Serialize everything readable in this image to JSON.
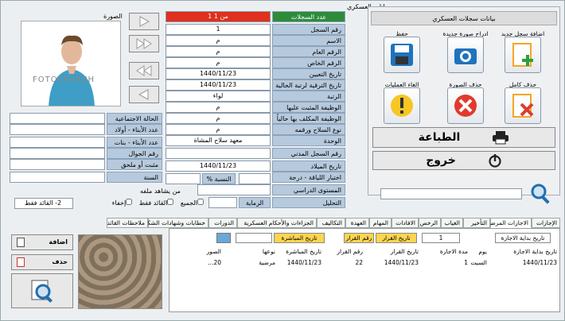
{
  "window": {
    "title": "بيانات العسكري"
  },
  "photo": {
    "label": "الصورة",
    "watermark": "FOTOSEARCH"
  },
  "record_header": {
    "label": "عدد السجلات",
    "value": "1 من 1"
  },
  "form_main": [
    {
      "label": "رقم السجل",
      "value": "1"
    },
    {
      "label": "الاسم",
      "value": "م"
    },
    {
      "label": "الرقم العام",
      "value": "م"
    },
    {
      "label": "الرقم الخاص",
      "value": "م"
    },
    {
      "label": "تاريخ التعيين",
      "value": "1440/11/23"
    },
    {
      "label": "تاريخ الترقية لرتبة الحالية",
      "value": "1440/11/23"
    },
    {
      "label": "الرتبة",
      "value": "لواء"
    },
    {
      "label": "الوظيفة المثبت عليها",
      "value": "م"
    },
    {
      "label": "الوظيفة المكلف بها حالياً",
      "value": "م"
    },
    {
      "label": "نوع السلاح ورقمه",
      "value": "م"
    },
    {
      "label": "الوحدة",
      "value": "معهد سلاح المشاة"
    },
    {
      "label": "رقم السجل المدني",
      "value": ""
    },
    {
      "label": "تاريخ الميلاد",
      "value": "1440/11/23"
    },
    {
      "label": "اختبار اللياقة - درجة",
      "value": ""
    },
    {
      "label": "المستوى الدراسي",
      "value": ""
    },
    {
      "label": "التحليل",
      "value": ""
    }
  ],
  "percent_label": "النسبة %",
  "rank_label": "الرماية",
  "form_left": [
    {
      "label": "الحالة الاجتماعية",
      "value": ""
    },
    {
      "label": "عدد الأبناء - أولاد",
      "value": ""
    },
    {
      "label": "عدد الأبناء - بنات",
      "value": ""
    },
    {
      "label": "رقم الجوال",
      "value": ""
    },
    {
      "label": "مثبت أو ملحق",
      "value": ""
    },
    {
      "label": "السنة",
      "value": ""
    }
  ],
  "viewer": {
    "label": "من يشاهد ملفه",
    "options": [
      "الجميع",
      "القائد فقط",
      "إخفاء"
    ],
    "select": "2- القائد فقط"
  },
  "panel": {
    "title": "بيانات سجلات العسكري"
  },
  "tiles": [
    {
      "label": "اضافة سجل جديد",
      "icon": "add-file-icon"
    },
    {
      "label": "ادراج صورة جديدة",
      "icon": "camera-icon"
    },
    {
      "label": "حفظ",
      "icon": "save-icon"
    },
    {
      "label": "حذف كامل",
      "icon": "delete-file-icon"
    },
    {
      "label": "حذف الصورة",
      "icon": "delete-photo-icon"
    },
    {
      "label": "الغاء العمليات",
      "icon": "cancel-icon"
    }
  ],
  "print": {
    "label": "الطباعة"
  },
  "exit": {
    "label": "خروج"
  },
  "tabs": [
    "الإجازات",
    "الاجازات المرضية",
    "التأخير",
    "الغياب",
    "الرخص",
    "الافادات",
    "المهام",
    "العهدة",
    "التكاليف",
    "الجزاءات والأحكام العسكرية",
    "الدورات",
    "خطابات وشهادات الشكر",
    "ملاحظات القائد"
  ],
  "filters": {
    "sort1": "تاريخ بداية الاجازة",
    "num": "1",
    "f1": "تاريخ القرار",
    "f2": "رقم القرار",
    "f3": "تاريخ المباشرة"
  },
  "table": {
    "headers": [
      "تاريخ بداية الاجازة",
      "يوم",
      "مدة الاجازة",
      "تاريخ القرار",
      "رقم القرار",
      "تاريخ المباشرة",
      "نوعها",
      "الصور"
    ],
    "row": [
      "1440/11/23",
      "السبت",
      "1",
      "1440/11/23",
      "22",
      "1440/11/23",
      "مرضية",
      "20..."
    ]
  },
  "side_buttons": {
    "add": "اضافة",
    "del": "حذف"
  }
}
